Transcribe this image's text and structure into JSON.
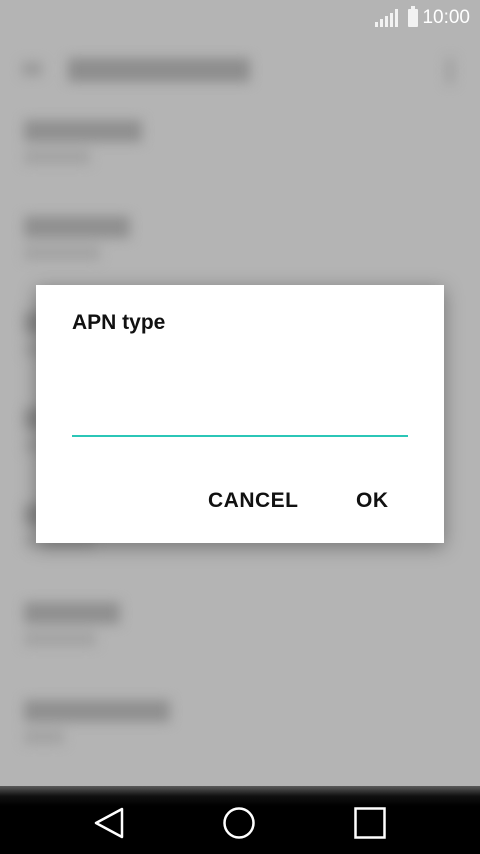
{
  "status_bar": {
    "time": "10:00"
  },
  "dialog": {
    "title": "APN type",
    "input_value": "",
    "cancel_label": "CANCEL",
    "ok_label": "OK"
  },
  "colors": {
    "accent": "#2bc6b7",
    "scrim": "#b4b4b4",
    "dialog_bg": "#ffffff",
    "nav_bar": "#000000"
  },
  "icons": {
    "status": [
      "signal-icon",
      "battery-icon"
    ],
    "nav": [
      "back-icon",
      "home-icon",
      "recent-apps-icon"
    ]
  }
}
